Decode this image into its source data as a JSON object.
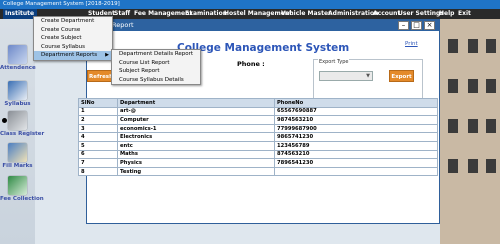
{
  "window": {
    "title": "College Management System [2018-2019]"
  },
  "menubar": [
    "Institute",
    "Student",
    "Staff",
    "Fee Management",
    "Examination",
    "Hostel Management",
    "Vehicle Master",
    "Administration",
    "Account",
    "User Settings",
    "Help",
    "Exit"
  ],
  "institute_menu": [
    "Create Department",
    "Create Course",
    "Create Subject",
    "Course Syllabus",
    "Department Reports"
  ],
  "reports_submenu": [
    "Department Details Report",
    "Course List Report",
    "Subject Report",
    "Course Syllabus Details"
  ],
  "sidebar": [
    "Attendence",
    "Syllabus",
    "Class Register",
    "Fill Marks",
    "Fee Collection"
  ],
  "child": {
    "title": "Report",
    "app_title": "College Management System",
    "print": "Print",
    "refresh": "Refresh",
    "phone_label": "Phone :",
    "export_type": "Export Type",
    "export_button": "Export"
  },
  "table": {
    "columns": [
      "SlNo",
      "Department",
      "PhoneNo"
    ],
    "rows": [
      [
        "1",
        "art-@",
        "65567690887"
      ],
      [
        "2",
        "Computer",
        "9874563210"
      ],
      [
        "3",
        "economics-1",
        "77999687900"
      ],
      [
        "4",
        "Electronics",
        "9865741230"
      ],
      [
        "5",
        "entc",
        "123456789"
      ],
      [
        "6",
        "Maths",
        "874563210"
      ],
      [
        "7",
        "Physics",
        "7896541230"
      ],
      [
        "8",
        "Testing",
        ""
      ]
    ]
  },
  "colors": {
    "titlebar": "#1f74c7",
    "menubar": "#2a2a2a",
    "accent": "#e48a2a",
    "heading": "#2d56b8"
  }
}
